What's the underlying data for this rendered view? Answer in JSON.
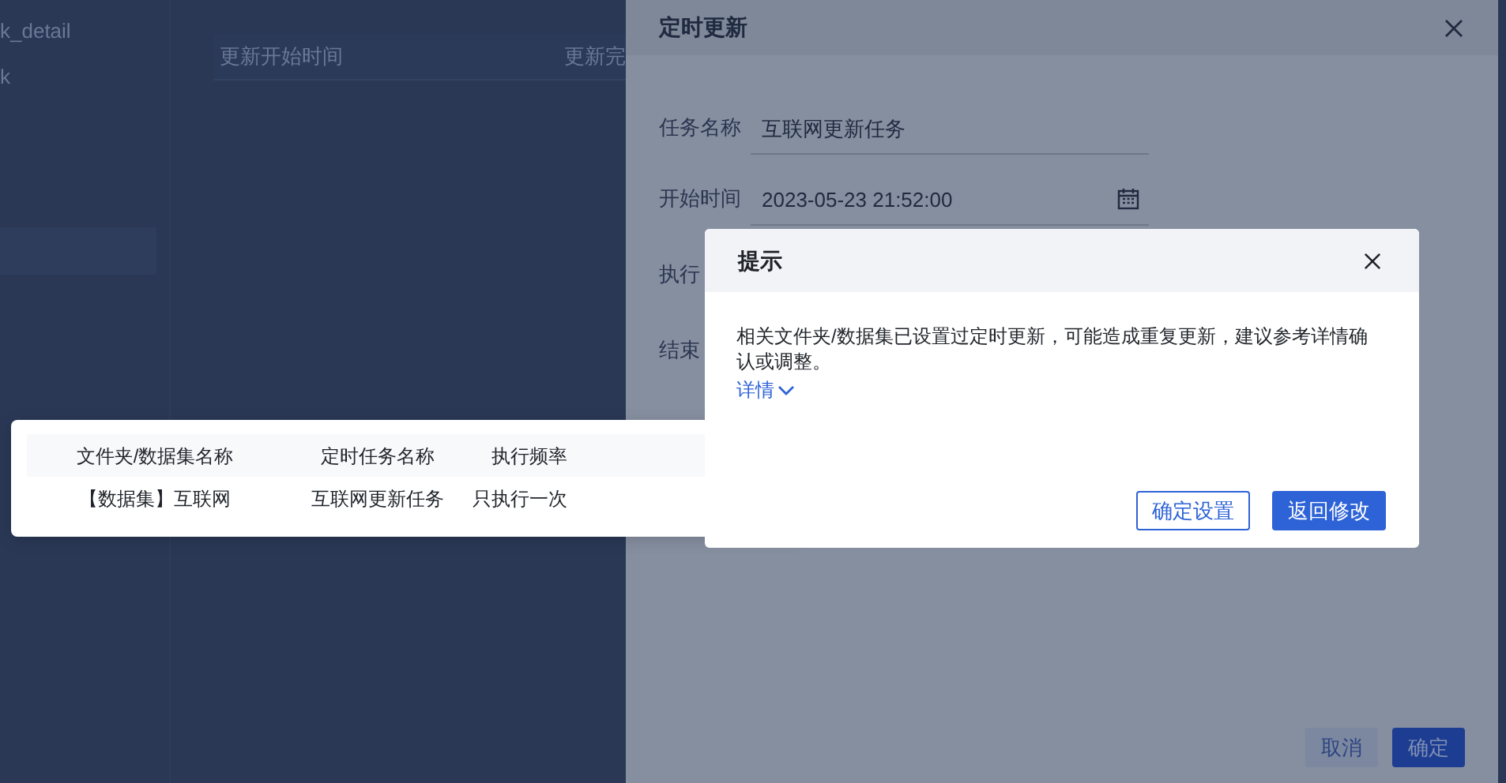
{
  "background": {
    "sidebar_items": [
      {
        "label": "k_detail",
        "selected": false
      },
      {
        "label": "k",
        "selected": false
      },
      {
        "selected": true
      }
    ],
    "table_columns": [
      "更新开始时间",
      "更新完"
    ]
  },
  "drawer": {
    "title": "定时更新",
    "fields": [
      {
        "kind": "text",
        "label": "任务名称",
        "value": "互联网更新任务"
      },
      {
        "kind": "date",
        "label": "开始时间",
        "value": "2023-05-23 21:52:00"
      },
      {
        "kind": "covered",
        "label": "执行"
      },
      {
        "kind": "covered",
        "label": "结束"
      }
    ],
    "buttons": [
      {
        "kind": "secondary",
        "label": "取消"
      },
      {
        "kind": "primary",
        "label": "确定"
      }
    ]
  },
  "dialog": {
    "title": "提示",
    "message": "相关文件夹/数据集已设置过定时更新，可能造成重复更新，建议参考详情确认或调整。",
    "details_link": "详情",
    "expanded": true,
    "buttons": [
      {
        "kind": "outline",
        "label": "确定设置"
      },
      {
        "kind": "primary",
        "label": "返回修改"
      }
    ]
  },
  "details_popover": {
    "columns": [
      "文件夹/数据集名称",
      "定时任务名称",
      "执行频率"
    ],
    "rows": [
      [
        "【数据集】互联网",
        "互联网更新任务",
        "只执行一次"
      ]
    ]
  }
}
